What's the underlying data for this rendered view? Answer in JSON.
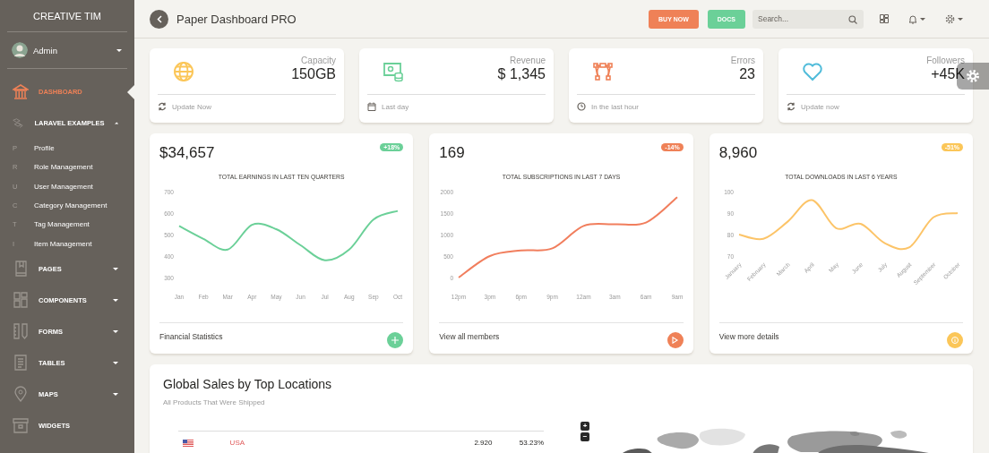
{
  "sidebar": {
    "logo": "CREATIVE TIM",
    "user": {
      "name": "Admin",
      "expanded": false
    },
    "items": [
      {
        "label": "DASHBOARD",
        "selected": true
      },
      {
        "label": "LARAVEL EXAMPLES",
        "selected": false,
        "expanded": true,
        "children": [
          {
            "abbr": "P",
            "label": "Profile"
          },
          {
            "abbr": "R",
            "label": "Role Management"
          },
          {
            "abbr": "U",
            "label": "User Management"
          },
          {
            "abbr": "C",
            "label": "Category Management"
          },
          {
            "abbr": "T",
            "label": "Tag Management"
          },
          {
            "abbr": "I",
            "label": "Item Management"
          }
        ]
      },
      {
        "label": "PAGES",
        "selected": false,
        "expanded": false
      },
      {
        "label": "COMPONENTS",
        "selected": false,
        "expanded": false
      },
      {
        "label": "FORMS",
        "selected": false,
        "expanded": false
      },
      {
        "label": "TABLES",
        "selected": false,
        "expanded": false
      },
      {
        "label": "MAPS",
        "selected": false,
        "expanded": false
      },
      {
        "label": "WIDGETS",
        "selected": false
      }
    ]
  },
  "navbar": {
    "title": "Paper Dashboard PRO",
    "buttons": [
      {
        "label": "BUY NOW",
        "color": "#ef8157"
      },
      {
        "label": "DOCS",
        "color": "#6bd098"
      }
    ],
    "search": {
      "placeholder": "Search..."
    }
  },
  "stats": [
    {
      "label": "Capacity",
      "value": "150GB",
      "footer": "Update Now",
      "color": "#fbc658"
    },
    {
      "label": "Revenue",
      "value": "$ 1,345",
      "footer": "Last day",
      "color": "#6bd098"
    },
    {
      "label": "Errors",
      "value": "23",
      "footer": "In the last hour",
      "color": "#ef8157"
    },
    {
      "label": "Followers",
      "value": "+45K",
      "footer": "Update now",
      "color": "#51bcda"
    }
  ],
  "charts": [
    {
      "value": "$34,657",
      "badge": "+18%",
      "color": "#6bd098",
      "footer": "Financial Statistics",
      "chart_data": {
        "type": "line",
        "title": "TOTAL EARNINGS IN LAST TEN QUARTERS",
        "categories": [
          "Jan",
          "Feb",
          "Mar",
          "Apr",
          "May",
          "Jun",
          "Jul",
          "Aug",
          "Sep",
          "Oct"
        ],
        "ylim": [
          300,
          700
        ],
        "yticks": [
          300,
          400,
          500,
          600,
          700
        ],
        "series": [
          {
            "color": "#6bd098",
            "values": [
              540,
              480,
              430,
              545,
              525,
              450,
              380,
              430,
              570,
              610
            ]
          }
        ]
      }
    },
    {
      "value": "169",
      "badge": "-14%",
      "color": "#ef8157",
      "footer": "View all members",
      "chart_data": {
        "type": "line",
        "title": "TOTAL SUBSCRIPTIONS IN LAST 7 DAYS",
        "categories": [
          "12pm",
          "3pm",
          "6pm",
          "9pm",
          "12am",
          "3am",
          "6am",
          "9am"
        ],
        "ylim": [
          0,
          2000
        ],
        "yticks": [
          0,
          500,
          1000,
          1500,
          2000
        ],
        "series": [
          {
            "color": "#f17e5d",
            "values": [
              0,
              500,
              630,
              680,
              1200,
              1240,
              1280,
              1870
            ]
          }
        ]
      }
    },
    {
      "value": "8,960",
      "badge": "-51%",
      "color": "#fbc658",
      "footer": "View more details",
      "chart_data": {
        "type": "line",
        "title": "TOTAL DOWNLOADS IN LAST 6 YEARS",
        "categories": [
          "January",
          "February",
          "March",
          "April",
          "May",
          "June",
          "July",
          "August",
          "September",
          "October"
        ],
        "ylim": [
          70,
          100
        ],
        "yticks": [
          70,
          80,
          90,
          100
        ],
        "series": [
          {
            "color": "#fcc468",
            "values": [
              80,
              78,
              86,
              96,
              83,
              85,
              76,
              74,
              88,
              90
            ]
          }
        ]
      }
    }
  ],
  "sales": {
    "title": "Global Sales by Top Locations",
    "subtitle": "All Products That Were Shipped",
    "rows": [
      {
        "country": "USA",
        "sales": "2.920",
        "share": "53.23%"
      }
    ],
    "map": {
      "zoom_in": "+",
      "zoom_out": "−"
    }
  }
}
